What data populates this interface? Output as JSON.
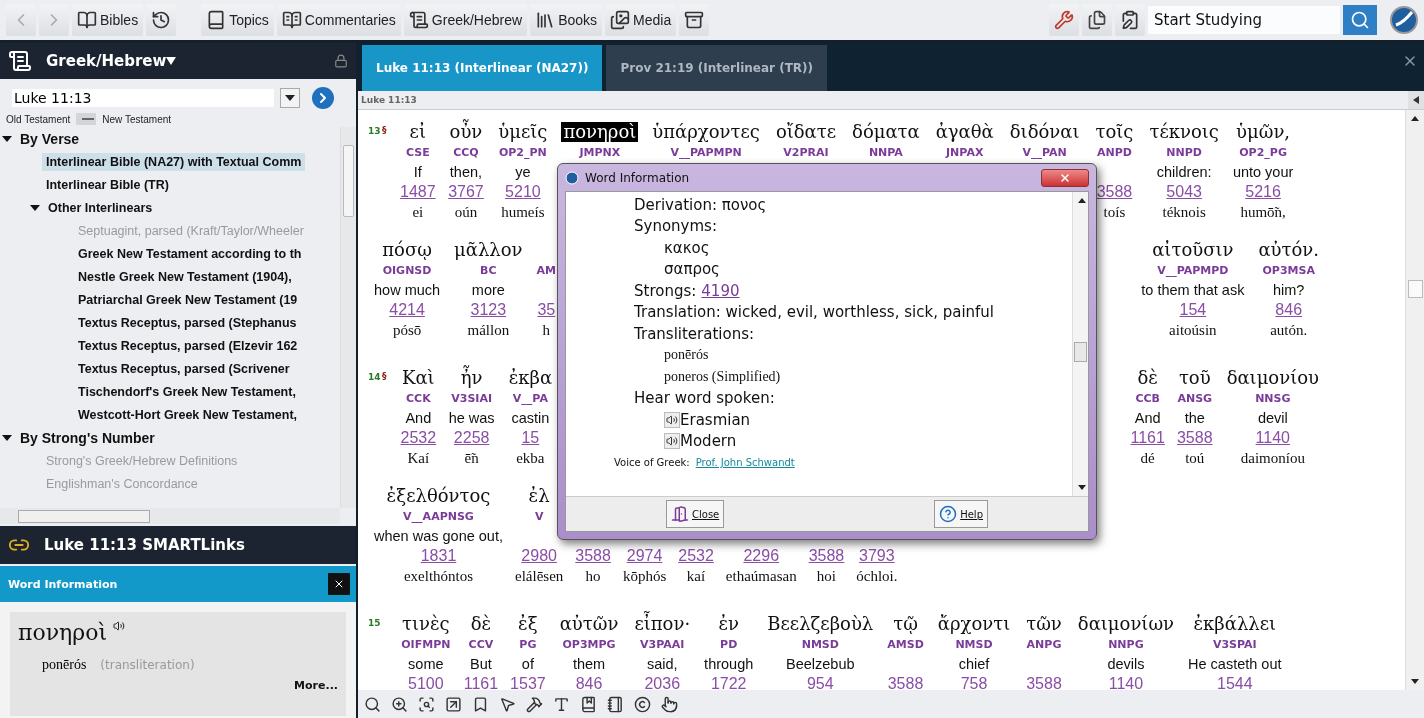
{
  "toolbar": {
    "buttons": [
      {
        "kind": "back"
      },
      {
        "kind": "forward"
      },
      {
        "kind": "bibles",
        "label": "Bibles"
      },
      {
        "kind": "history"
      },
      {
        "kind": "topics",
        "label": "Topics"
      },
      {
        "kind": "commentaries",
        "label": "Commentaries"
      },
      {
        "kind": "greek",
        "label": "Greek/Hebrew"
      },
      {
        "kind": "books",
        "label": "Books"
      },
      {
        "kind": "media",
        "label": "Media"
      },
      {
        "kind": "layout"
      }
    ],
    "search": {
      "value": "Start Studying"
    }
  },
  "left_panel": {
    "title": "Greek/Hebrew",
    "reference": {
      "value": "Luke 11:13"
    },
    "testament_left": "Old Testament",
    "testament_right": "New Testament",
    "testament_toggle": {
      "on": true
    },
    "tree": [
      {
        "label": "By Verse",
        "expanded": true,
        "selected": false,
        "disabled": false,
        "children": [
          {
            "label": "Interlinear Bible (NA27) with Textual Comm",
            "selected": true,
            "disabled": false
          },
          {
            "label": "Interlinear Bible (TR)",
            "selected": false,
            "disabled": false
          },
          {
            "label": "Other Interlinears",
            "expanded": true,
            "selected": false,
            "disabled": false,
            "children": [
              {
                "label": "Septuagint, parsed (Kraft/Taylor/Wheeler",
                "selected": false,
                "disabled": true
              },
              {
                "label": "Greek New Testament according to th",
                "selected": false,
                "disabled": false
              },
              {
                "label": "Nestle Greek New Testament (1904),",
                "selected": false,
                "disabled": false
              },
              {
                "label": "Patriarchal Greek New Testament (19",
                "selected": false,
                "disabled": false
              },
              {
                "label": "Textus Receptus, parsed (Stephanus",
                "selected": false,
                "disabled": false
              },
              {
                "label": "Textus Receptus, parsed (Elzevir 162",
                "selected": false,
                "disabled": false
              },
              {
                "label": "Textus Receptus, parsed (Scrivener",
                "selected": false,
                "disabled": false
              },
              {
                "label": "Tischendorf's Greek New Testament,",
                "selected": false,
                "disabled": false
              },
              {
                "label": "Westcott-Hort Greek New Testament,",
                "selected": false,
                "disabled": false
              }
            ]
          }
        ]
      },
      {
        "label": "By Strong's Number",
        "expanded": true,
        "selected": false,
        "disabled": false,
        "children": [
          {
            "label": "Strong's Greek/Hebrew Definitions",
            "selected": false,
            "disabled": true
          },
          {
            "label": "Englishman's Concordance",
            "selected": false,
            "disabled": true
          }
        ]
      }
    ],
    "smartlinks_title": "Luke 11:13 SMARTLinks",
    "word_panel": {
      "title": "Word Information",
      "word": "πονηροὶ",
      "transliteration": "ponērós",
      "note": "(transliteration)",
      "more": "More..."
    }
  },
  "tabs": [
    {
      "label": "Luke 11:13 (Interlinear (NA27))",
      "selected": true
    },
    {
      "label": "Prov 21:19 (Interlinear (TR))",
      "selected": false
    }
  ],
  "breadcrumb": "Luke 11:13",
  "verses": [
    {
      "number": "13",
      "mark": "§",
      "lines": [
        {
          "words": [
            {
              "greek": "εἰ",
              "parsing": "CSE",
              "english": "If",
              "strong": "1487",
              "translit": "ei",
              "selected": false
            },
            {
              "greek": "οὖν",
              "parsing": "CCQ",
              "english": "then,",
              "strong": "3767",
              "translit": "oún",
              "selected": false
            },
            {
              "greek": "ὑμεῖς",
              "parsing": "OP2_PN",
              "english": "ye",
              "strong": "5210",
              "translit": "humeís",
              "selected": false
            },
            {
              "greek": "πονηροὶ",
              "parsing": "JMPNX",
              "selected": true
            },
            {
              "greek": "ὑπάρχοντες",
              "parsing": "V__PAPMPN",
              "selected": false
            },
            {
              "greek": "οἴδατε",
              "parsing": "V2PRAI",
              "selected": false
            },
            {
              "greek": "δόματα",
              "parsing": "NNPA",
              "selected": false
            },
            {
              "greek": "ἀγαθὰ",
              "parsing": "JNPAX",
              "selected": false
            },
            {
              "greek": "διδόναι",
              "parsing": "V__PAN",
              "selected": false
            },
            {
              "greek": "τοῖς",
              "parsing": "ANPD",
              "strong": "3588",
              "translit": "toís",
              "selected": false
            },
            {
              "greek": "τέκνοις",
              "parsing": "NNPD",
              "english": "children:",
              "strong": "5043",
              "translit": "téknois",
              "selected": false
            },
            {
              "greek": "ὑμῶν,",
              "parsing": "OP2_PG",
              "english": "unto your",
              "strong": "5216",
              "translit": "humō̃n,",
              "selected": false
            }
          ]
        },
        {
          "words": [
            {
              "greek": "πόσῳ",
              "parsing": "OIGNSD",
              "english": "how much",
              "strong": "4214",
              "translit": "pósō",
              "selected": false
            },
            {
              "greek": "μᾶλλον",
              "parsing": "BC",
              "english": "more",
              "strong": "3123",
              "translit": "mállon",
              "selected": false
            },
            {
              "parsing": "AM",
              "strong": "35",
              "translit": "h",
              "selected": false
            }
          ],
          "words_right": [
            {
              "greek": "αἰτοῦσιν",
              "parsing": "V__PAPMPD",
              "english": "to them that ask",
              "strong": "154",
              "translit": "aitoúsin",
              "selected": false
            },
            {
              "greek": "αὐτόν.",
              "parsing": "OP3MSA",
              "english": "him?",
              "strong": "846",
              "translit": "autón.",
              "selected": false
            }
          ]
        }
      ]
    },
    {
      "number": "14",
      "mark": "§",
      "lines": [
        {
          "words": [
            {
              "greek": "Καὶ",
              "parsing": "CCK",
              "english": "And",
              "strong": "2532",
              "translit": "Kaí",
              "selected": false
            },
            {
              "greek": "ἦν",
              "parsing": "V3SIAI",
              "english": "he was",
              "strong": "2258",
              "translit": "ē̃n",
              "selected": false
            },
            {
              "greek": "ἐκβα",
              "parsing": "V__PA",
              "english": "castin",
              "strong": "15",
              "translit": "ekba",
              "selected": false
            }
          ],
          "words_right": [
            {
              "greek": "δὲ",
              "parsing": "CCB",
              "english": "And",
              "strong": "1161",
              "translit": "dé",
              "selected": false
            },
            {
              "greek": "τοῦ",
              "parsing": "ANSG",
              "english": "the",
              "strong": "3588",
              "translit": "toú",
              "selected": false
            },
            {
              "greek": "δαιμονίου",
              "parsing": "NNSG",
              "english": "devil",
              "strong": "1140",
              "translit": "daimoníou",
              "selected": false
            }
          ]
        },
        {
          "words": [
            {
              "greek": "ἐξελθόντος",
              "parsing": "V__AAPNSG",
              "english": "when was gone out,",
              "strong": "1831",
              "translit": "exelthóntos",
              "selected": false
            },
            {
              "greek": "ἐλ",
              "parsing": "V",
              "strong": "2980",
              "translit": "elálēsen",
              "selected": false
            },
            {
              "strong": "3588",
              "translit": "ho",
              "selected": false
            },
            {
              "strong": "2974",
              "translit": "kōphós",
              "selected": false
            },
            {
              "strong": "2532",
              "translit": "kaí",
              "selected": false
            },
            {
              "strong": "2296",
              "translit": "ethaúmasan",
              "selected": false
            },
            {
              "strong": "3588",
              "translit": "hoi",
              "selected": false
            },
            {
              "strong": "3793",
              "translit": "óchloi.",
              "selected": false
            }
          ]
        }
      ]
    },
    {
      "number": "15",
      "lines": [
        {
          "words": [
            {
              "greek": "τινὲς",
              "parsing": "OIFMPN",
              "english": "some",
              "strong": "5100",
              "selected": false
            },
            {
              "greek": "δὲ",
              "parsing": "CCV",
              "english": "But",
              "strong": "1161",
              "selected": false
            },
            {
              "greek": "ἐξ",
              "parsing": "PG",
              "english": "of",
              "strong": "1537",
              "selected": false
            },
            {
              "greek": "αὐτῶν",
              "parsing": "OP3MPG",
              "english": "them",
              "strong": "846",
              "selected": false
            },
            {
              "greek": "εἶπον·",
              "parsing": "V3PAAI",
              "english": "said,",
              "strong": "2036",
              "selected": false
            },
            {
              "greek": "ἐν",
              "parsing": "PD",
              "english": "through",
              "strong": "1722",
              "selected": false
            },
            {
              "greek": "Βεελζεβοὺλ",
              "parsing": "NMSD",
              "english": "Beelzebub",
              "strong": "954",
              "selected": false
            },
            {
              "greek": "τῷ",
              "parsing": "AMSD",
              "strong": "3588",
              "selected": false
            },
            {
              "greek": "ἄρχοντι",
              "parsing": "NMSD",
              "english": "chief",
              "strong": "758",
              "selected": false
            },
            {
              "greek": "τῶν",
              "parsing": "ANPG",
              "strong": "3588",
              "selected": false
            },
            {
              "greek": "δαιμονίων",
              "parsing": "NNPG",
              "english": "devils",
              "strong": "1140",
              "selected": false
            },
            {
              "greek": "ἐκβάλλει",
              "parsing": "V3SPAI",
              "english": "He casteth out",
              "strong": "1544",
              "selected": false
            }
          ]
        }
      ]
    }
  ],
  "dialog": {
    "title": "Word Information",
    "rows": [
      {
        "kind": "field",
        "label": "Derivation:",
        "value": "πονος"
      },
      {
        "kind": "heading",
        "label": "Synonyms:"
      },
      {
        "kind": "item",
        "value": "κακος"
      },
      {
        "kind": "item",
        "value": "σαπρος"
      },
      {
        "kind": "link",
        "label": "Strongs:",
        "value": "4190"
      },
      {
        "kind": "field",
        "label": "Translation:",
        "value": "wicked, evil, worthless, sick, painful"
      },
      {
        "kind": "heading",
        "label": "Transliterations:"
      },
      {
        "kind": "small",
        "value": "ponērós"
      },
      {
        "kind": "small",
        "value": "poneros (Simplified)"
      },
      {
        "kind": "heading",
        "label": "Hear word spoken:"
      },
      {
        "kind": "audio",
        "value": "Erasmian"
      },
      {
        "kind": "audio",
        "value": "Modern"
      },
      {
        "kind": "credit",
        "label": "Voice of Greek:",
        "value": "Prof. John Schwandt"
      }
    ],
    "buttons": [
      {
        "kind": "close",
        "label": "Close"
      },
      {
        "kind": "help",
        "label": "Help"
      }
    ]
  }
}
